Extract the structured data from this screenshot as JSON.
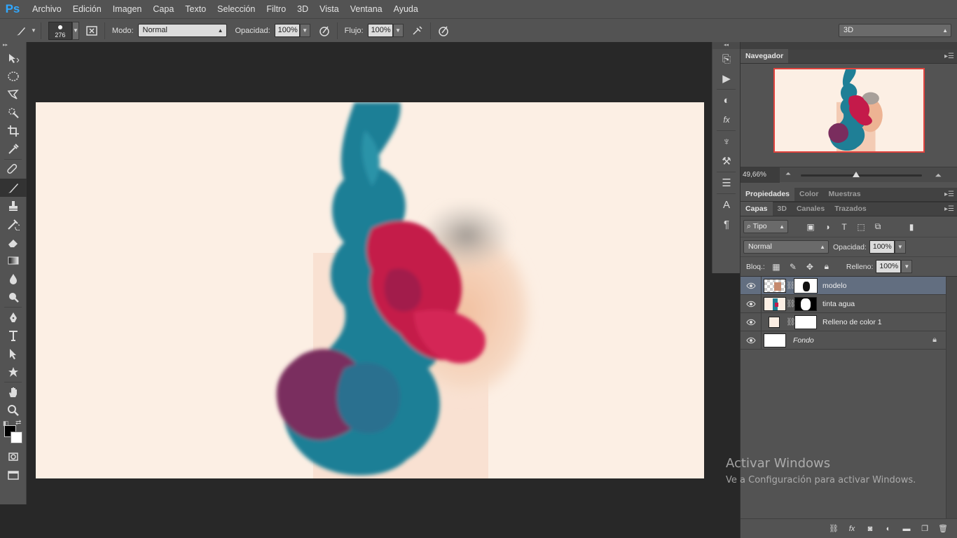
{
  "app": {
    "logo": "Ps"
  },
  "menu": [
    "Archivo",
    "Edición",
    "Imagen",
    "Capa",
    "Texto",
    "Selección",
    "Filtro",
    "3D",
    "Vista",
    "Ventana",
    "Ayuda"
  ],
  "options": {
    "brush_size": "276",
    "mode_label": "Modo:",
    "mode_value": "Normal",
    "opacity_label": "Opacidad:",
    "opacity_value": "100%",
    "flow_label": "Flujo:",
    "flow_value": "100%",
    "workspace": "3D"
  },
  "navigator": {
    "tab": "Navegador",
    "zoom": "49,66%"
  },
  "properties_tabs": [
    "Propiedades",
    "Color",
    "Muestras"
  ],
  "layers_tabs": [
    "Capas",
    "3D",
    "Canales",
    "Trazados"
  ],
  "layers_panel": {
    "filter_kind": "Tipo",
    "blend_mode": "Normal",
    "opacity_label": "Opacidad:",
    "opacity_value": "100%",
    "lock_label": "Bloq.:",
    "fill_label": "Relleno:",
    "fill_value": "100%"
  },
  "layers": [
    {
      "name": "modelo",
      "selected": true
    },
    {
      "name": "tinta agua",
      "selected": false
    },
    {
      "name": "Relleno de color 1",
      "selected": false
    },
    {
      "name": "Fondo",
      "selected": false
    }
  ],
  "colors": {
    "foreground": "#000000",
    "background": "#ffffff",
    "canvas_fill": "#fcefe4",
    "ink_teal": "#1f7f96",
    "ink_red": "#c41a4a",
    "accent_nav": "#e0433e"
  },
  "watermark": {
    "title": "Activar Windows",
    "subtitle": "Ve a Configuración para activar Windows."
  }
}
